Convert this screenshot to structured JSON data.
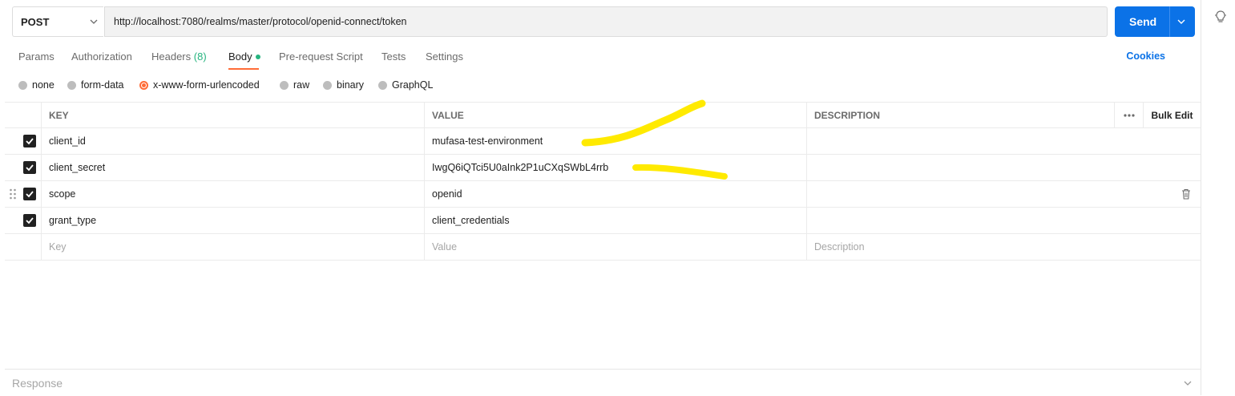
{
  "request": {
    "method": "POST",
    "url": "http://localhost:7080/realms/master/protocol/openid-connect/token",
    "send_label": "Send"
  },
  "tabs": [
    {
      "label": "Params"
    },
    {
      "label": "Authorization"
    },
    {
      "label": "Headers",
      "count": "(8)"
    },
    {
      "label": "Body"
    },
    {
      "label": "Pre-request Script"
    },
    {
      "label": "Tests"
    },
    {
      "label": "Settings"
    }
  ],
  "cookies_label": "Cookies",
  "body_types": [
    {
      "label": "none"
    },
    {
      "label": "form-data"
    },
    {
      "label": "x-www-form-urlencoded",
      "selected": true
    },
    {
      "label": "raw"
    },
    {
      "label": "binary"
    },
    {
      "label": "GraphQL"
    }
  ],
  "table": {
    "headers": {
      "key": "KEY",
      "value": "VALUE",
      "description": "DESCRIPTION",
      "bulk_edit": "Bulk Edit"
    },
    "rows": [
      {
        "key": "client_id",
        "value": "mufasa-test-environment",
        "checked": true
      },
      {
        "key": "client_secret",
        "value": "IwgQ6iQTci5U0aInk2P1uCXqSWbL4rrb",
        "checked": true
      },
      {
        "key": "scope",
        "value": "openid",
        "checked": true
      },
      {
        "key": "grant_type",
        "value": "client_credentials",
        "checked": true
      }
    ],
    "placeholders": {
      "key": "Key",
      "value": "Value",
      "description": "Description"
    }
  },
  "response_label": "Response",
  "colors": {
    "accent": "#0b72e7",
    "active_tab": "#ff6c37",
    "highlight": "#ffea00"
  }
}
